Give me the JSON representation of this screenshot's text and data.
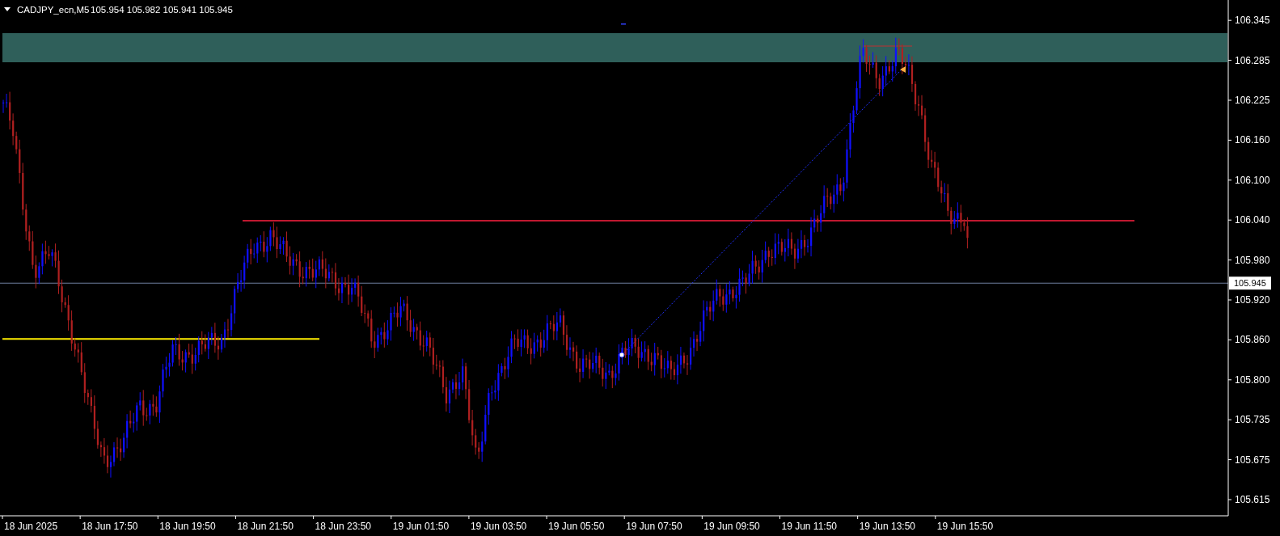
{
  "symbol": {
    "title": "CADJPY_ecn,M5",
    "quotes": "105.954 105.982 105.941 105.945"
  },
  "price_axis": {
    "ticks": [
      "106.345",
      "106.285",
      "106.225",
      "106.160",
      "106.100",
      "106.040",
      "105.980",
      "105.920",
      "105.860",
      "105.800",
      "105.735",
      "105.675",
      "105.615"
    ],
    "current_price": "105.945"
  },
  "time_axis": {
    "labels": [
      "18 Jun 2025",
      "18 Jun 17:50",
      "18 Jun 19:50",
      "18 Jun 21:50",
      "18 Jun 23:50",
      "19 Jun 01:50",
      "19 Jun 03:50",
      "19 Jun 05:50",
      "19 Jun 07:50",
      "19 Jun 09:50",
      "19 Jun 11:50",
      "19 Jun 13:50",
      "19 Jun 15:50"
    ]
  }
}
